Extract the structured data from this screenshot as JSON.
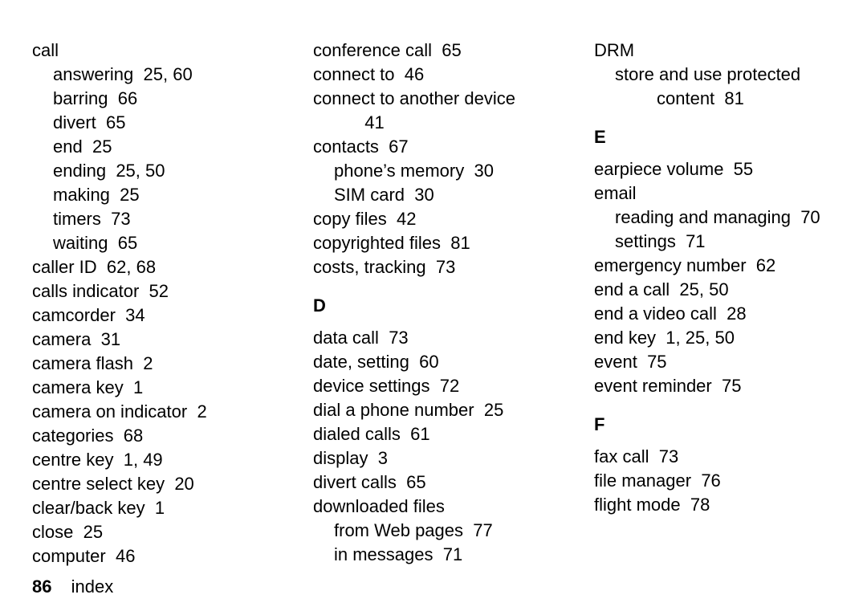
{
  "page_number": "86",
  "footer_label": "index",
  "columns": [
    {
      "items": [
        {
          "indent": 0,
          "text": "call"
        },
        {
          "indent": 1,
          "text": "answering",
          "pages": "25, 60"
        },
        {
          "indent": 1,
          "text": "barring",
          "pages": "66"
        },
        {
          "indent": 1,
          "text": "divert",
          "pages": "65"
        },
        {
          "indent": 1,
          "text": "end",
          "pages": "25"
        },
        {
          "indent": 1,
          "text": "ending",
          "pages": "25, 50"
        },
        {
          "indent": 1,
          "text": "making",
          "pages": "25"
        },
        {
          "indent": 1,
          "text": "timers",
          "pages": "73"
        },
        {
          "indent": 1,
          "text": "waiting",
          "pages": "65"
        },
        {
          "indent": 0,
          "text": "caller ID",
          "pages": "62, 68"
        },
        {
          "indent": 0,
          "text": "calls indicator",
          "pages": "52"
        },
        {
          "indent": 0,
          "text": "camcorder",
          "pages": "34"
        },
        {
          "indent": 0,
          "text": "camera",
          "pages": "31"
        },
        {
          "indent": 0,
          "text": "camera flash",
          "pages": "2"
        },
        {
          "indent": 0,
          "text": "camera key",
          "pages": "1"
        },
        {
          "indent": 0,
          "text": "camera on indicator",
          "pages": "2"
        },
        {
          "indent": 0,
          "text": "categories",
          "pages": "68"
        },
        {
          "indent": 0,
          "text": "centre key",
          "pages": "1, 49"
        },
        {
          "indent": 0,
          "text": "centre select key",
          "pages": "20"
        },
        {
          "indent": 0,
          "text": "clear/back key",
          "pages": "1"
        },
        {
          "indent": 0,
          "text": "close",
          "pages": "25"
        },
        {
          "indent": 0,
          "text": "computer",
          "pages": "46"
        }
      ]
    },
    {
      "items": [
        {
          "indent": 0,
          "text": "conference call",
          "pages": "65"
        },
        {
          "indent": 0,
          "text": "connect to",
          "pages": "46"
        },
        {
          "indent": 0,
          "text": "connect to another device"
        },
        {
          "indent": 2,
          "text": "",
          "pages": "41"
        },
        {
          "indent": 0,
          "text": "contacts",
          "pages": "67"
        },
        {
          "indent": 1,
          "text": "phone’s memory",
          "pages": "30"
        },
        {
          "indent": 1,
          "text": "SIM card",
          "pages": "30"
        },
        {
          "indent": 0,
          "text": "copy files",
          "pages": "42"
        },
        {
          "indent": 0,
          "text": "copyrighted files",
          "pages": "81"
        },
        {
          "indent": 0,
          "text": "costs, tracking",
          "pages": "73"
        },
        {
          "heading": "D"
        },
        {
          "indent": 0,
          "text": "data call",
          "pages": "73"
        },
        {
          "indent": 0,
          "text": "date, setting",
          "pages": "60"
        },
        {
          "indent": 0,
          "text": "device settings",
          "pages": "72"
        },
        {
          "indent": 0,
          "text": "dial a phone number",
          "pages": "25"
        },
        {
          "indent": 0,
          "text": "dialed calls",
          "pages": "61"
        },
        {
          "indent": 0,
          "text": "display",
          "pages": "3"
        },
        {
          "indent": 0,
          "text": "divert calls",
          "pages": "65"
        },
        {
          "indent": 0,
          "text": "downloaded files"
        },
        {
          "indent": 1,
          "text": "from Web pages",
          "pages": "77"
        },
        {
          "indent": 1,
          "text": "in messages",
          "pages": "71"
        }
      ]
    },
    {
      "items": [
        {
          "indent": 0,
          "text": "DRM"
        },
        {
          "indent": 1,
          "text": "store and use protected"
        },
        {
          "indent": 3,
          "text": "content",
          "pages": "81"
        },
        {
          "heading": "E"
        },
        {
          "indent": 0,
          "text": "earpiece volume",
          "pages": "55"
        },
        {
          "indent": 0,
          "text": "email"
        },
        {
          "indent": 1,
          "text": "reading and managing",
          "pages": "70"
        },
        {
          "indent": 1,
          "text": "settings",
          "pages": "71"
        },
        {
          "indent": 0,
          "text": "emergency number",
          "pages": "62"
        },
        {
          "indent": 0,
          "text": "end a call",
          "pages": "25, 50"
        },
        {
          "indent": 0,
          "text": "end a video call",
          "pages": "28"
        },
        {
          "indent": 0,
          "text": "end key",
          "pages": "1, 25, 50"
        },
        {
          "indent": 0,
          "text": "event",
          "pages": "75"
        },
        {
          "indent": 0,
          "text": "event reminder",
          "pages": "75"
        },
        {
          "heading": "F"
        },
        {
          "indent": 0,
          "text": "fax call",
          "pages": "73"
        },
        {
          "indent": 0,
          "text": "file manager",
          "pages": "76"
        },
        {
          "indent": 0,
          "text": "flight mode",
          "pages": "78"
        }
      ]
    }
  ]
}
